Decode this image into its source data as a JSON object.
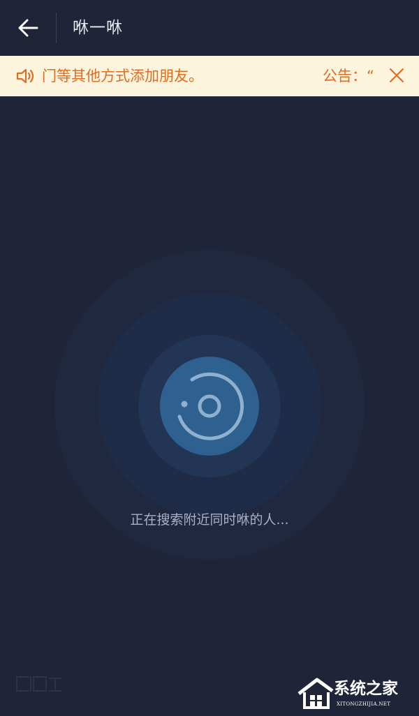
{
  "app": {
    "title": "咻一咻"
  },
  "header": {
    "back_icon": "arrow-left-icon"
  },
  "notice": {
    "icon": "speaker-icon",
    "message": "门等其他方式添加朋友。",
    "label": "公告：“",
    "close_icon": "close-icon",
    "color": "#e06c22",
    "background": "#fdf4dd"
  },
  "scan": {
    "icon": "radar-target-icon",
    "status": "正在搜索附近同时咻的人...",
    "button_color": "#2f6190"
  },
  "colors": {
    "background": "#1f2438",
    "title_text": "#e9ebf2",
    "status_text": "#a9b0c4"
  },
  "watermarks": {
    "site_name": "系统之家",
    "site_domain": "XITONGZHIJIA.NET"
  }
}
